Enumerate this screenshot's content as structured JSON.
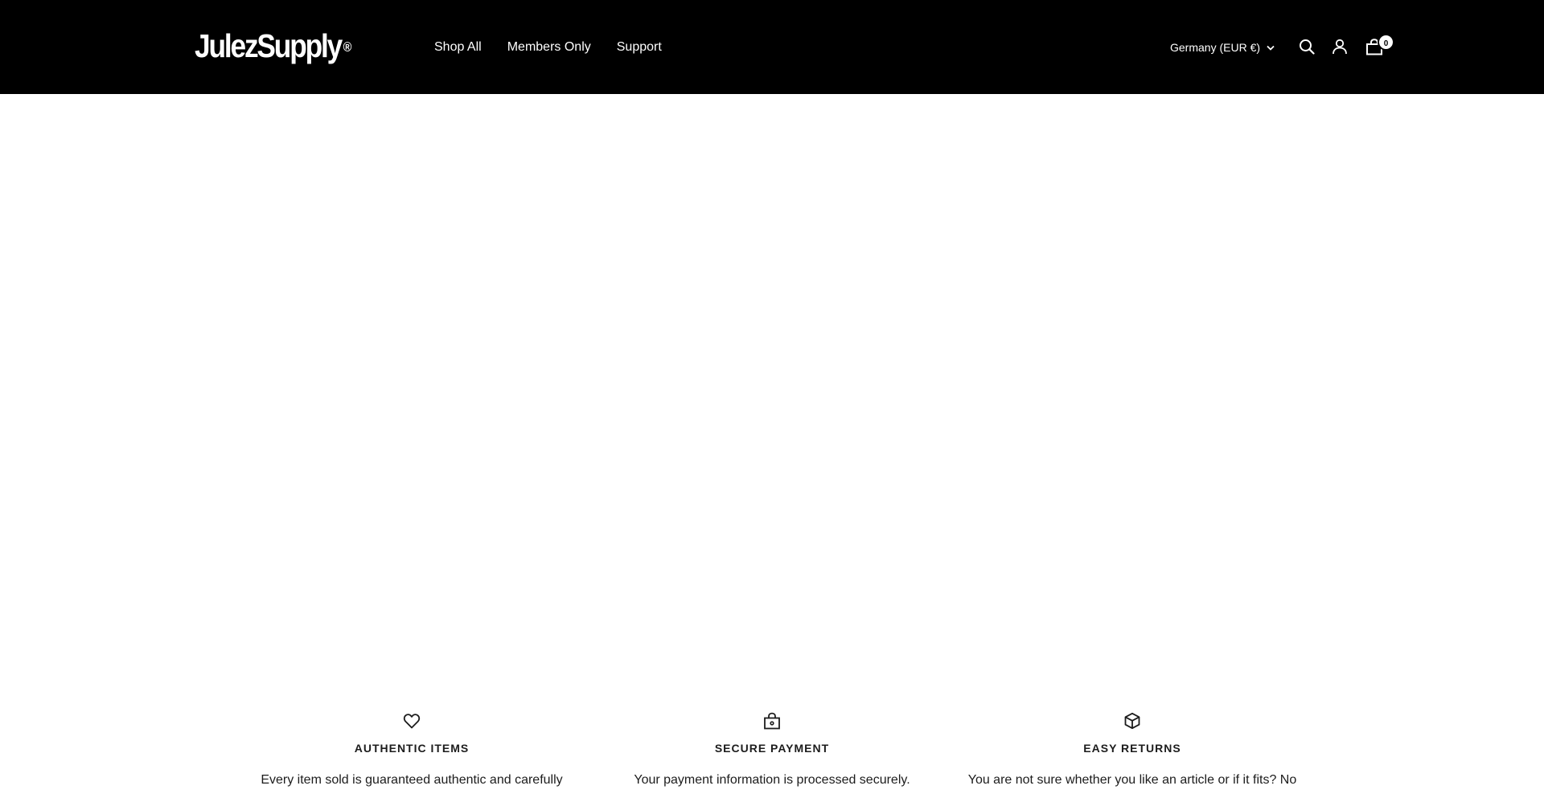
{
  "header": {
    "logo": "JulezSupply",
    "logo_mark": "®",
    "nav": [
      {
        "label": "Shop All"
      },
      {
        "label": "Members Only"
      },
      {
        "label": "Support"
      }
    ],
    "locale": "Germany (EUR €)",
    "icons": {
      "locale_chevron": "chevron-down-icon",
      "search": "search-icon",
      "account": "account-icon",
      "cart": "cart-icon"
    },
    "cart_count": "0"
  },
  "features": [
    {
      "icon": "heart-icon",
      "title": "AUTHENTIC ITEMS",
      "text": "Every item sold is guaranteed authentic and carefully"
    },
    {
      "icon": "lock-bag-icon",
      "title": "SECURE PAYMENT",
      "text": "Your payment information is processed securely."
    },
    {
      "icon": "box-icon",
      "title": "EASY RETURNS",
      "text": "You are not sure whether you like an article or if it fits? No"
    }
  ],
  "colors": {
    "header_bg": "#000000",
    "header_text": "#ffffff",
    "body_bg": "#ffffff",
    "body_text": "#1c1c1c"
  }
}
